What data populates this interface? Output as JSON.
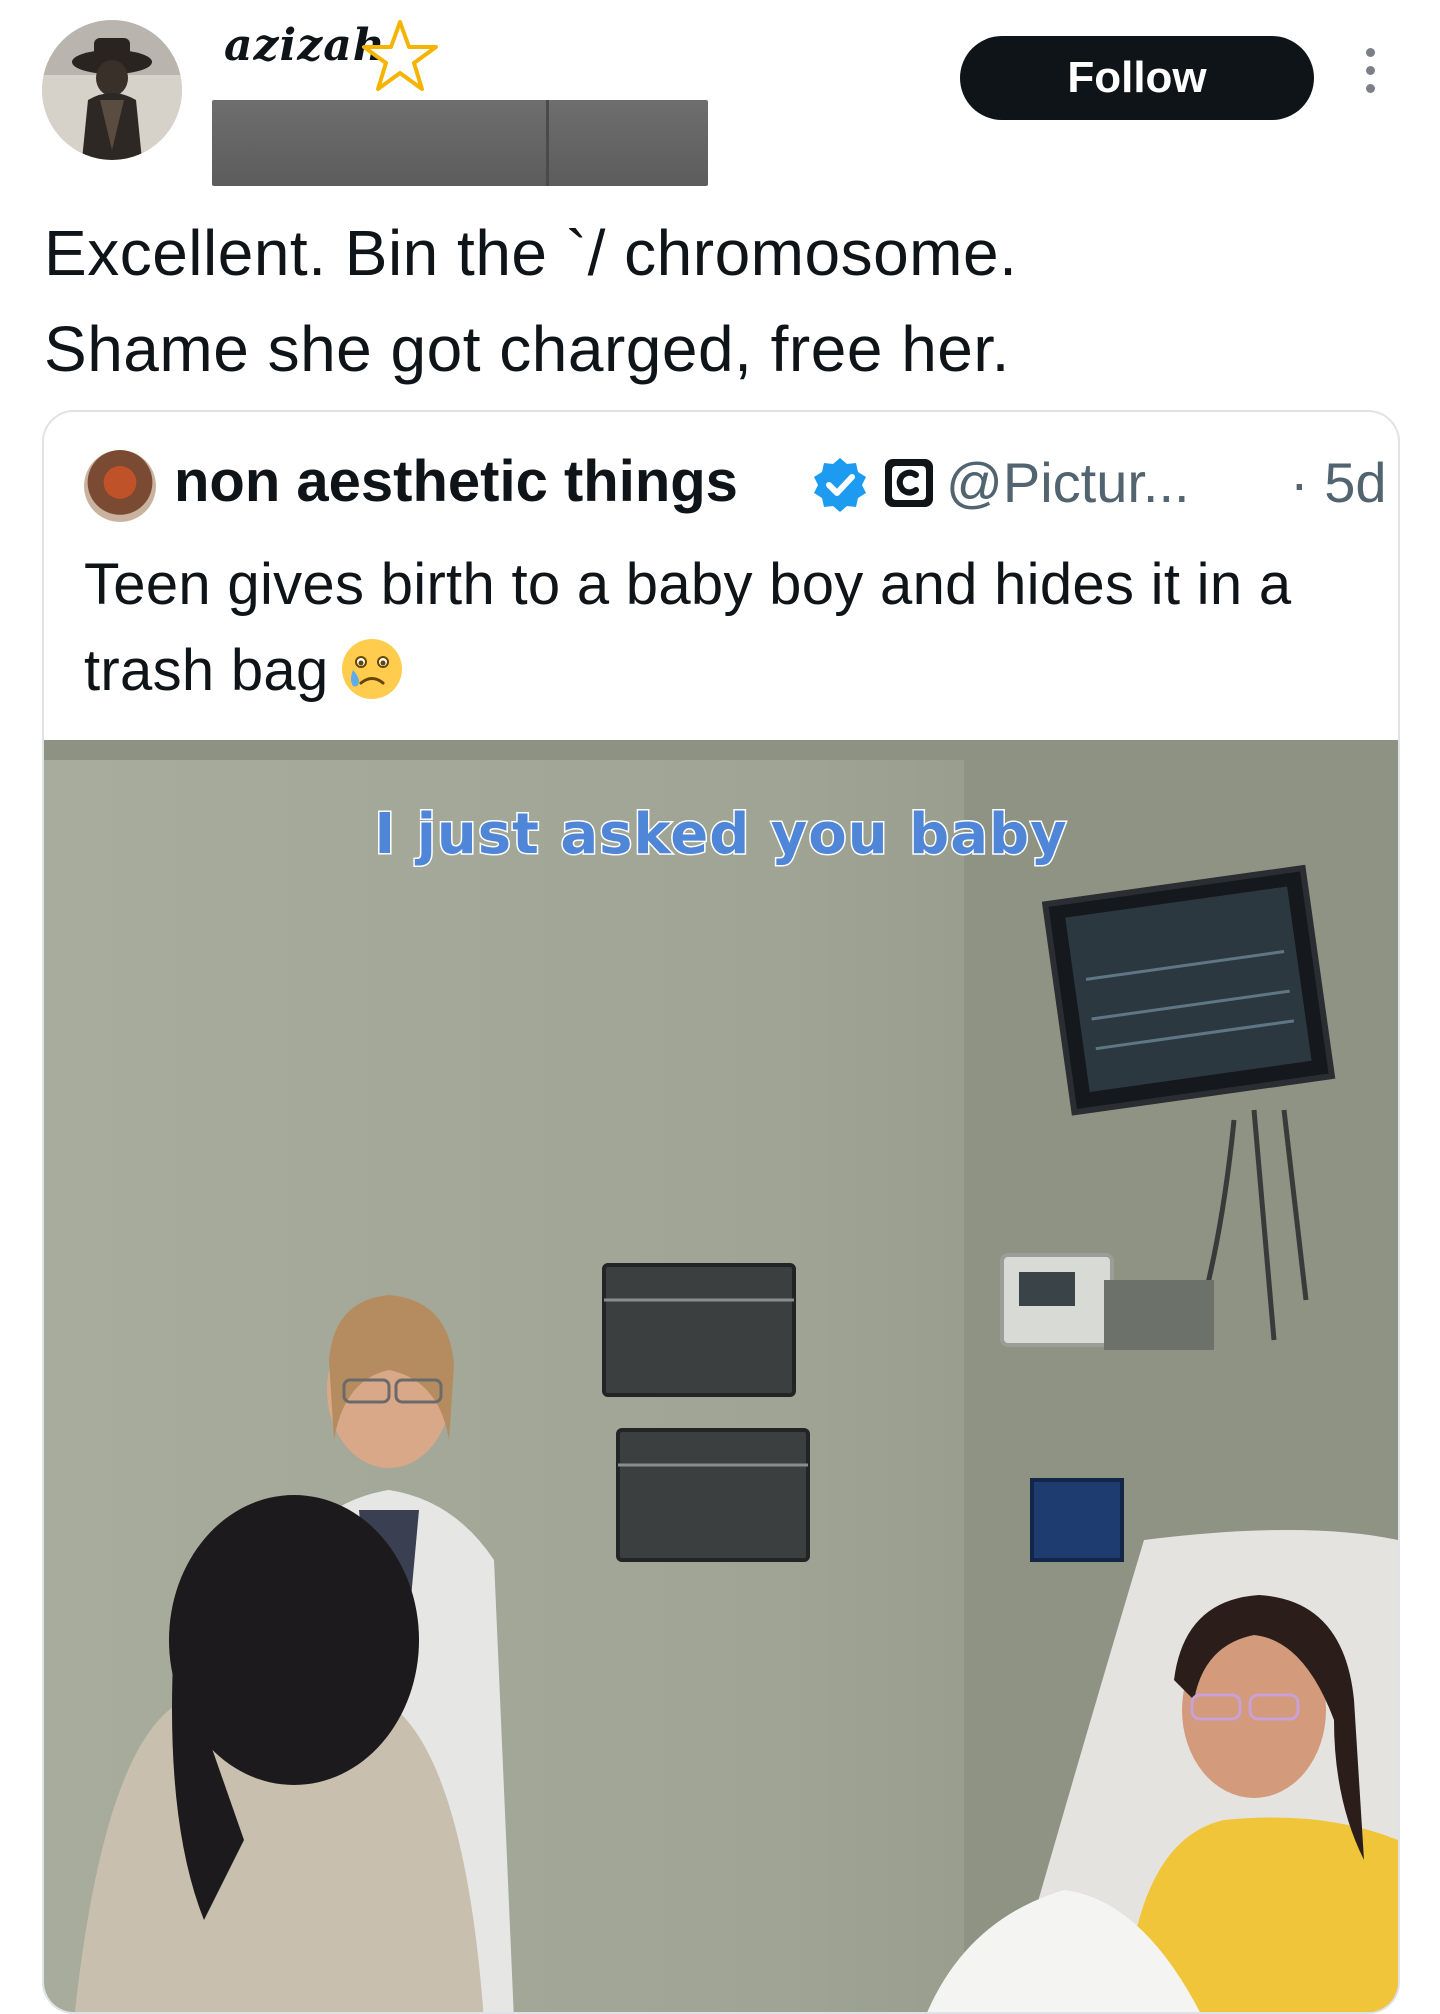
{
  "header": {
    "display_name": "azizah",
    "follow_label": "Follow"
  },
  "tweet": {
    "text": "Excellent. Bin the `/ chromosome.\nShame she got charged, free her."
  },
  "quote": {
    "name": "non aesthetic things",
    "handle": "@Pictur...",
    "time": "· 5d",
    "text": "Teen gives birth to a baby boy and hides it in a trash bag",
    "media_caption": "I just asked you baby"
  },
  "icons": [
    "star-icon",
    "more-icon",
    "verified-icon",
    "square-badge-icon",
    "crying-face-emoji"
  ],
  "colors": {
    "follow_bg": "#0f1419",
    "verified": "#1d9bf0",
    "caption": "#4f86d8",
    "secondary_text": "#536471"
  }
}
